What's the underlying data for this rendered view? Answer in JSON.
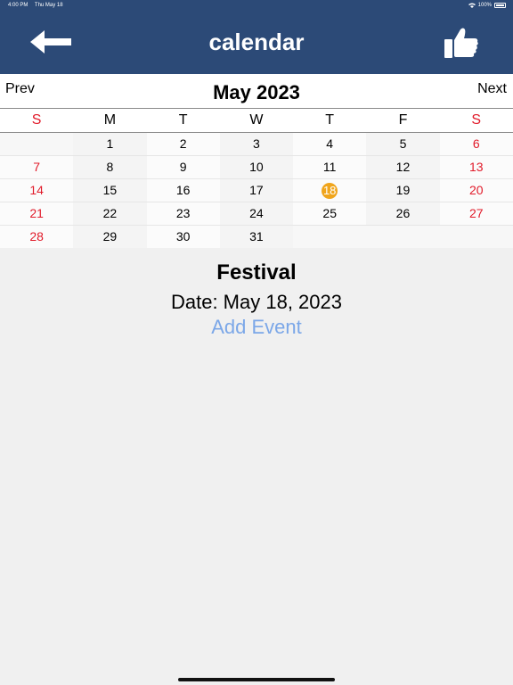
{
  "status_bar": {
    "time": "4:00 PM",
    "date": "Thu May 18",
    "battery": "100%"
  },
  "nav": {
    "title": "calendar",
    "back_icon": "arrow-left-icon",
    "like_icon": "thumbs-up-icon"
  },
  "month": {
    "prev_label": "Prev",
    "title": "May 2023",
    "next_label": "Next"
  },
  "weekdays": [
    "S",
    "M",
    "T",
    "W",
    "T",
    "F",
    "S"
  ],
  "weeks": [
    [
      "",
      "1",
      "2",
      "3",
      "4",
      "5",
      "6"
    ],
    [
      "7",
      "8",
      "9",
      "10",
      "11",
      "12",
      "13"
    ],
    [
      "14",
      "15",
      "16",
      "17",
      "18",
      "19",
      "20"
    ],
    [
      "21",
      "22",
      "23",
      "24",
      "25",
      "26",
      "27"
    ],
    [
      "28",
      "29",
      "30",
      "31",
      "",
      "",
      ""
    ]
  ],
  "selected_day": "18",
  "event": {
    "title": "Festival",
    "date": "Date: May 18, 2023",
    "add_label": "Add Event"
  },
  "colors": {
    "nav_bg": "#2c4a77",
    "weekend": "#e11b2a",
    "today": "#f0a51c",
    "link": "#7ba7e8"
  }
}
